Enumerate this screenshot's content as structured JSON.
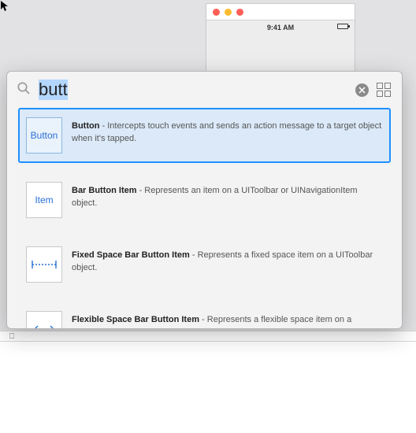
{
  "cursor_glyph": "▲",
  "iphone": {
    "status_time": "9:41 AM"
  },
  "search": {
    "value": "butt"
  },
  "results": [
    {
      "thumb_label": "Button",
      "title": "Button",
      "desc": "Intercepts touch events and sends an action message to a target object when it's tapped.",
      "selected": true,
      "icon": "text"
    },
    {
      "thumb_label": "Item",
      "title": "Bar Button Item",
      "desc": "Represents an item on a UIToolbar or UINavigationItem object.",
      "selected": false,
      "icon": "text"
    },
    {
      "thumb_label": "",
      "title": "Fixed Space Bar Button Item",
      "desc": "Represents a fixed space item on a UIToolbar object.",
      "selected": false,
      "icon": "fixed"
    },
    {
      "thumb_label": "",
      "title": "Flexible Space Bar Button Item",
      "desc": "Represents a flexible space item on a UIToolbar object.",
      "selected": false,
      "icon": "flex"
    }
  ],
  "bottom_glyph": "⎕"
}
